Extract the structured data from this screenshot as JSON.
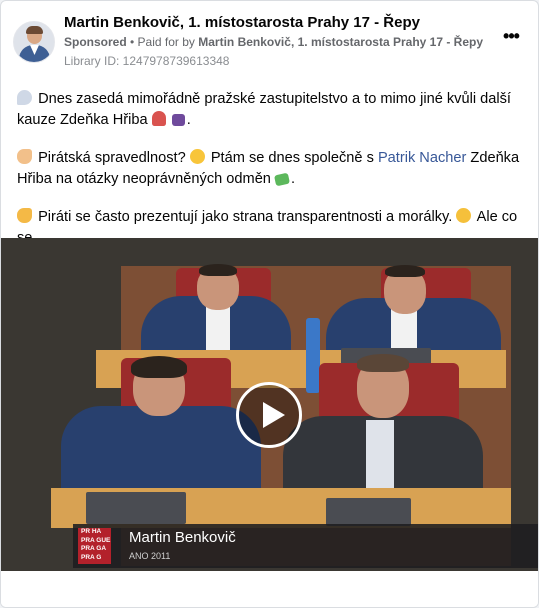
{
  "post": {
    "page_name": "Martin Benkovič, 1. místostarosta Prahy 17 - Řepy",
    "sponsored_label": "Sponsored",
    "separator": " • ",
    "paid_for_label": "Paid for by ",
    "paid_for_name": "Martin Benkovič, 1. místostarosta Prahy 17 - Řepy",
    "library_id": "Library ID: 1247978739613348",
    "more_icon": "more-options-icon",
    "more_glyph": "•••"
  },
  "text": {
    "p1": "Dnes zasedá mimořádně pražské zastupitelstvo a to mimo jiné kvůli další kauze Zdeňka Hřiba",
    "p2_a": "Pirátská spravedlnost?",
    "p2_b": "Ptám se dnes společně s",
    "p2_link": "Patrik Nacher",
    "p2_c": "Zdeňka Hřiba na otázky neoprávněných odměn",
    "p3": "Piráti se často prezentují jako strana transparentnosti a morálky.",
    "p3_b": "Ale co se…",
    "emojis": [
      "speech-bubble-icon",
      "mushroom-icon",
      "skull-icon",
      "pointing-hand-icon",
      "thinking-face-icon",
      "money-icon",
      "pointing-hand-icon",
      "grinning-face-icon"
    ]
  },
  "video": {
    "play_icon": "play-icon",
    "lower_third_name": "Martin Benkovič",
    "lower_third_party": "ANO 2011",
    "logo_lines": [
      "PR HA",
      "PRA GUE",
      "PRA GA",
      "PRA G"
    ]
  },
  "colors": {
    "link": "#385898",
    "logo_red": "#b3212b",
    "meta_gray": "#65676b"
  }
}
